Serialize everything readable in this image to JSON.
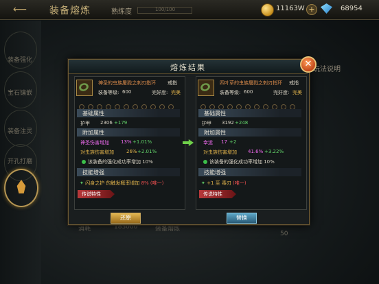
{
  "topbar": {
    "title": "装备熔炼",
    "proficiency_label": "熟练度",
    "proficiency_bar_text": "100/100",
    "gold": "11163W",
    "diamond": "68954"
  },
  "sidebar": {
    "items": [
      "装备强化",
      "宝石镶嵌",
      "装备注灵",
      "开孔打磨",
      "装备熔炼"
    ]
  },
  "background": {
    "side_tab": "玩法说明",
    "bottom_label": "消耗",
    "bottom_value": "183000",
    "bottom_button": "装备熔炼",
    "bottom_count": "50"
  },
  "dialog": {
    "title": "熔炼结果",
    "left": {
      "name": "神圣的虫族屠戮之刺刃指环",
      "type": "戒指",
      "level_label": "装备等级:",
      "level": "600",
      "condition_label": "完好度:",
      "condition": "完美",
      "base_header": "基础属性",
      "armor_label": "护甲",
      "armor_value": "2306",
      "armor_bonus": "+179",
      "extra_header": "附加属性",
      "attr1_label": "神圣伤害增加",
      "attr1_value": "13%",
      "attr1_bonus": "+1.01%",
      "attr2_label": "对虫族伤害增加",
      "attr2_value": "26%",
      "attr2_bonus": "+2.01%",
      "note": "该装备的强化成功率增加 10%",
      "skill_header": "技能增强",
      "skill_text": "闪身之护 的触发概率增加",
      "skill_value": "8%",
      "skill_tag": "(唯一)",
      "legend": "传说特性"
    },
    "right": {
      "name": "四叶草的虫族屠戮之刺刃指环",
      "type": "戒指",
      "level_label": "装备等级:",
      "level": "600",
      "condition_label": "完好度:",
      "condition": "完美",
      "base_header": "基础属性",
      "armor_label": "护甲",
      "armor_value": "3192",
      "armor_bonus": "+248",
      "extra_header": "附加属性",
      "attr1_label": "幸运",
      "attr1_value": "17",
      "attr1_bonus": "+2",
      "attr2_label": "对虫族伤害增加",
      "attr2_value": "41.6%",
      "attr2_bonus": "+3.22%",
      "note": "该装备的强化成功率增加 10%",
      "skill_header": "技能增强",
      "skill_text": "+1 至 毒刃",
      "skill_tag": "(唯一)",
      "legend": "传说特性"
    },
    "restore_button": "还原",
    "replace_button": "替换"
  },
  "colors": {
    "gold_border": "#a88845",
    "green": "#63d36a",
    "pink": "#f06cf0",
    "red": "#f05050"
  }
}
